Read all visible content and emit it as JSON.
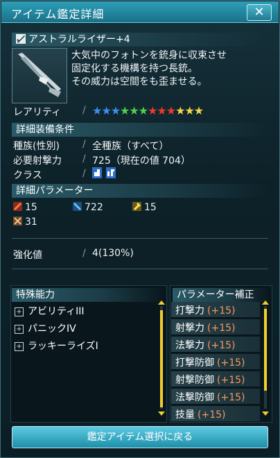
{
  "window": {
    "title": "アイテム鑑定詳細",
    "close_label": "✕"
  },
  "item": {
    "name": "アストラルライザー+4",
    "description": [
      "大気中のフォトンを銃身に収束させ",
      "固定化する機構を持つ長銃。",
      "その威力は空間をも歪ませる。"
    ]
  },
  "rarity": {
    "label": "レアリティ",
    "stars": [
      {
        "glyph": "★",
        "color": "#3d8ef0"
      },
      {
        "glyph": "★",
        "color": "#3d8ef0"
      },
      {
        "glyph": "★",
        "color": "#3d8ef0"
      },
      {
        "glyph": "★",
        "color": "#4fd24a"
      },
      {
        "glyph": "★",
        "color": "#4fd24a"
      },
      {
        "glyph": "★",
        "color": "#4fd24a"
      },
      {
        "glyph": "★",
        "color": "#f03a2a"
      },
      {
        "glyph": "★",
        "color": "#f03a2a"
      },
      {
        "glyph": "★",
        "color": "#f03a2a"
      },
      {
        "glyph": "★",
        "color": "#f2d64a"
      },
      {
        "glyph": "★",
        "color": "#f2d64a"
      },
      {
        "glyph": "★",
        "color": "#f2d64a"
      }
    ]
  },
  "requirements": {
    "header": "詳細装備条件",
    "race_label": "種族(性別)",
    "race_value": "全種族（すべて）",
    "shoot_label": "必要射撃力",
    "shoot_value": "725（現在の値 704）",
    "class_label": "クラス"
  },
  "parameters": {
    "header": "詳細パラメーター",
    "melee": "15",
    "ranged": "722",
    "tech": "15",
    "dex": "31"
  },
  "grind": {
    "label": "強化値",
    "value": "4(130%)"
  },
  "abilities": {
    "header": "特殊能力",
    "items": [
      "アビリティIII",
      "パニックIV",
      "ラッキーライズI"
    ]
  },
  "bonus": {
    "header": "パラメーター補正",
    "items": [
      {
        "name": "打撃力",
        "value": "(+15)"
      },
      {
        "name": "射撃力",
        "value": "(+15)"
      },
      {
        "name": "法撃力",
        "value": "(+15)"
      },
      {
        "name": "打撃防御",
        "value": "(+15)"
      },
      {
        "name": "射撃防御",
        "value": "(+15)"
      },
      {
        "name": "法撃防御",
        "value": "(+15)"
      },
      {
        "name": "技量",
        "value": "(+15)"
      }
    ]
  },
  "footer": {
    "back_label": "鑑定アイテム選択に戻る"
  },
  "colors": {
    "accent": "#2d9fb8",
    "bonus_value": "#f59a62",
    "scroll_thumb": "#f1cf2d"
  }
}
